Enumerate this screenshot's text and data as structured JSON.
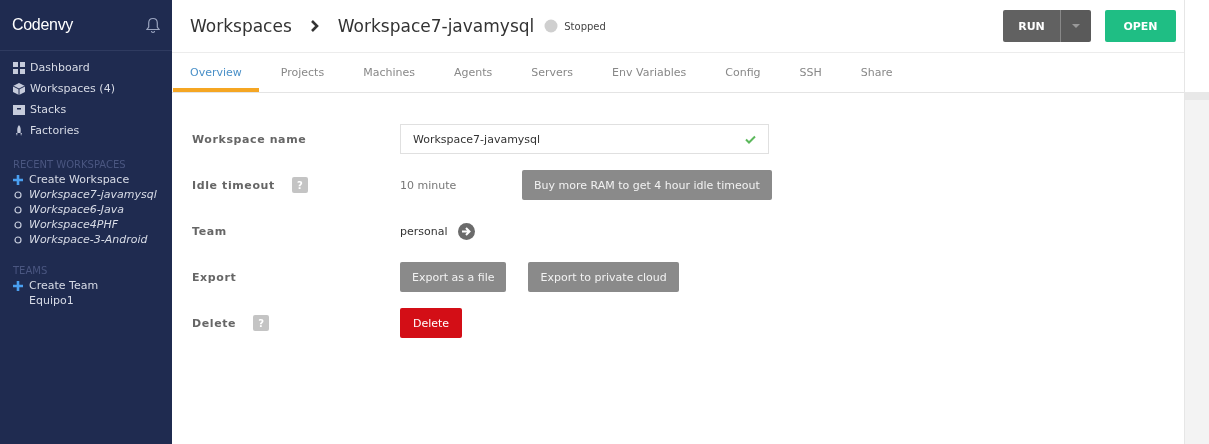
{
  "sidebar": {
    "logo": "Codenvy",
    "nav": [
      {
        "label": "Dashboard",
        "selected": false
      },
      {
        "label": "Workspaces (4)",
        "selected": false
      },
      {
        "label": "Stacks",
        "selected": false
      },
      {
        "label": "Factories",
        "selected": false
      }
    ],
    "recent_heading": "RECENT WORKSPACES",
    "recent": [
      {
        "label": "Create Workspace",
        "kind": "create"
      },
      {
        "label": "Workspace7-javamysql",
        "kind": "workspace"
      },
      {
        "label": "Workspace6-Java",
        "kind": "workspace"
      },
      {
        "label": "Workspace4PHF",
        "kind": "workspace"
      },
      {
        "label": "Workspace-3-Android",
        "kind": "workspace"
      }
    ],
    "teams_heading": "TEAMS",
    "teams": [
      {
        "label": "Create Team",
        "kind": "create"
      },
      {
        "label": "Equipo1",
        "kind": "team"
      }
    ]
  },
  "header": {
    "breadcrumb": "Workspaces",
    "title": "Workspace7-javamysql",
    "status": "Stopped",
    "buttons": {
      "run": "RUN",
      "open": "OPEN"
    }
  },
  "tabs": [
    {
      "label": "Overview",
      "selected": true
    },
    {
      "label": "Projects",
      "selected": false
    },
    {
      "label": "Machines",
      "selected": false
    },
    {
      "label": "Agents",
      "selected": false
    },
    {
      "label": "Servers",
      "selected": false
    },
    {
      "label": "Env Variables",
      "selected": false
    },
    {
      "label": "Config",
      "selected": false
    },
    {
      "label": "SSH",
      "selected": false
    },
    {
      "label": "Share",
      "selected": false
    }
  ],
  "form": [
    {
      "label": "Workspace name",
      "kind": "input",
      "value": "Workspace7-javamysql",
      "valid": true
    },
    {
      "label": "Idle timeout",
      "help": "?",
      "kind": "timeout",
      "value": "10 minute",
      "buttons": [
        "Buy more RAM to get 4 hour idle timeout"
      ]
    },
    {
      "label": "Team",
      "kind": "link",
      "value": "personal"
    },
    {
      "label": "Export",
      "kind": "buttons",
      "buttons": [
        "Export as a file",
        "Export to private cloud"
      ]
    },
    {
      "label": "Delete",
      "help": "?",
      "kind": "danger",
      "buttons": [
        "Delete"
      ]
    }
  ]
}
